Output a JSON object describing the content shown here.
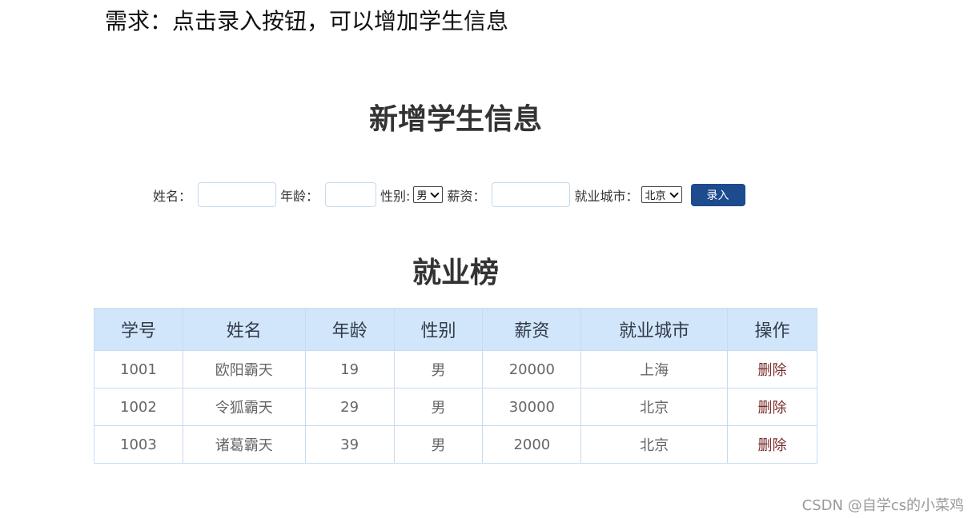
{
  "requirement": "需求：点击录入按钮，可以增加学生信息",
  "form": {
    "title": "新增学生信息",
    "name_label": "姓名：",
    "name_value": "",
    "age_label": "年龄：",
    "age_value": "",
    "gender_label": "性别:",
    "gender_selected": "男",
    "salary_label": "薪资：",
    "salary_value": "",
    "city_label": "就业城市：",
    "city_selected": "北京",
    "submit_label": "录入",
    "accent_color": "#1e4a8e"
  },
  "board": {
    "title": "就业榜",
    "columns": [
      "学号",
      "姓名",
      "年龄",
      "性别",
      "薪资",
      "就业城市",
      "操作"
    ],
    "header_color": "#d2e6fb",
    "rows": [
      {
        "id": "1001",
        "name": "欧阳霸天",
        "age": "19",
        "gender": "男",
        "salary": "20000",
        "city": "上海",
        "action": "删除"
      },
      {
        "id": "1002",
        "name": "令狐霸天",
        "age": "29",
        "gender": "男",
        "salary": "30000",
        "city": "北京",
        "action": "删除"
      },
      {
        "id": "1003",
        "name": "诸葛霸天",
        "age": "39",
        "gender": "男",
        "salary": "2000",
        "city": "北京",
        "action": "删除"
      }
    ]
  },
  "watermark": "CSDN @自学cs的小菜鸡"
}
